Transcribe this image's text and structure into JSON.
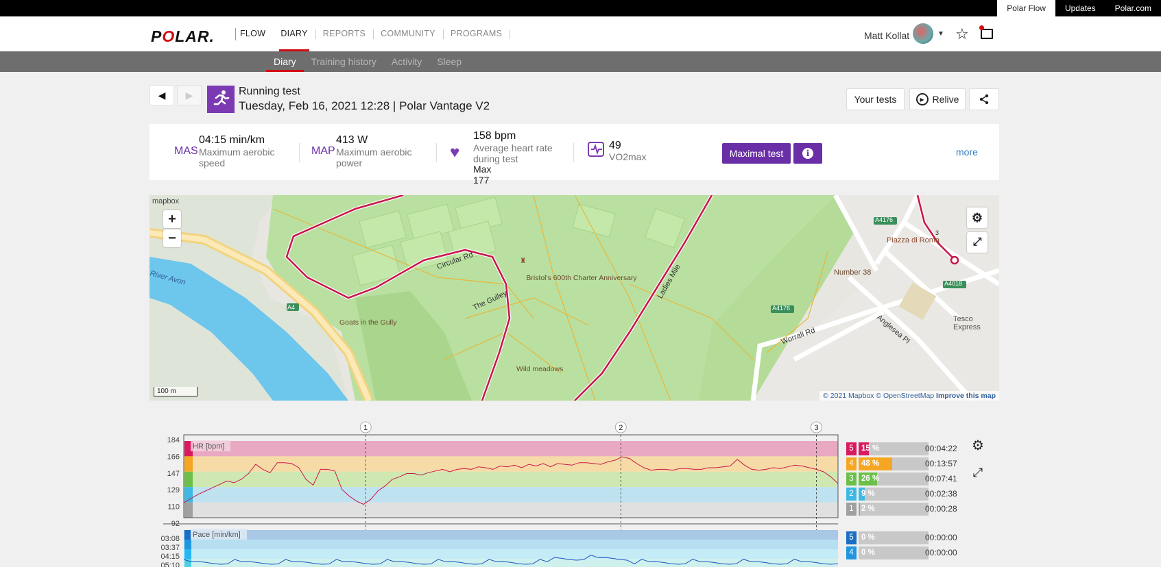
{
  "topbar": {
    "links": [
      "Polar Flow",
      "Updates",
      "Polar.com"
    ],
    "active": "Polar Flow"
  },
  "brand": {
    "logo_text": "POLAR."
  },
  "nav": {
    "items": [
      {
        "label": "FLOW"
      },
      {
        "label": "DIARY"
      },
      {
        "label": "REPORTS"
      },
      {
        "label": "COMMUNITY"
      },
      {
        "label": "PROGRAMS"
      }
    ],
    "active": "DIARY"
  },
  "user": {
    "name": "Matt Kollat"
  },
  "icons": {
    "star": "star-icon",
    "messages": "messages-icon",
    "avatar": "avatar"
  },
  "subnav": {
    "items": [
      "Diary",
      "Training history",
      "Activity",
      "Sleep"
    ],
    "active": "Diary"
  },
  "session": {
    "title": "Running test",
    "subtitle": "Tuesday, Feb 16, 2021 12:28 | Polar Vantage V2",
    "buttons": {
      "tests": "Your tests",
      "relive": "Relive"
    }
  },
  "summary": {
    "mas": {
      "abbr": "MAS",
      "value": "04:15 min/km",
      "desc": "Maximum aerobic speed"
    },
    "map": {
      "abbr": "MAP",
      "value": "413 W",
      "desc": "Maximum aerobic power"
    },
    "hr": {
      "value": "158 bpm",
      "desc": "Average heart rate during test",
      "max": "Max 177"
    },
    "vo2": {
      "value": "49",
      "desc": "VO2max"
    },
    "maximal_test_label": "Maximal test",
    "more_label": "more"
  },
  "map": {
    "labels": {
      "mapbox": "mapbox",
      "scale": "100 m",
      "circular_rd": "Circular Rd",
      "charter": "Bristol's 600th Charter Anniversary",
      "gulley": "The Gulley",
      "goats": "Goats in the Gully",
      "wild": "Wild meadows",
      "ladies": "Ladies Mile",
      "piazza": "Piazza di Roma",
      "number38": "Number 38",
      "tesco": "Tesco Express",
      "worrall": "Worrall Rd",
      "anglesea": "Anglesea Pl",
      "avon": "River Avon",
      "a4": "A4",
      "a4176a": "A4176",
      "a4176b": "A4176",
      "a4018": "A4018",
      "lap3": "3"
    },
    "attribution": {
      "copy": "© 2021 Mapbox",
      "osm": "© OpenStreetMap",
      "improve": "Improve this map"
    },
    "controls": {
      "zoom_in": "+",
      "zoom_out": "−"
    }
  },
  "chart_data": [
    {
      "type": "line",
      "title": "HR [bpm]",
      "ylabel": "HR [bpm]",
      "y_ticks": [
        "184",
        "166",
        "147",
        "129",
        "110",
        "92"
      ],
      "ylim": [
        92,
        184
      ],
      "lap_markers": [
        "1",
        "2",
        "3"
      ],
      "lap_positions_fraction": [
        0.278,
        0.668,
        0.967
      ],
      "zones": [
        {
          "zone": "5",
          "percent": "15 %",
          "time": "00:04:22",
          "color": "#d81b60"
        },
        {
          "zone": "4",
          "percent": "48 %",
          "time": "00:13:57",
          "color": "#f5a623"
        },
        {
          "zone": "3",
          "percent": "26 %",
          "time": "00:07:41",
          "color": "#6cc04a"
        },
        {
          "zone": "2",
          "percent": "9 %",
          "time": "00:02:38",
          "color": "#3fb9e3"
        },
        {
          "zone": "1",
          "percent": "2 %",
          "time": "00:00:28",
          "color": "#a0a0a0"
        }
      ],
      "series": [
        {
          "values": [
            110,
            115,
            120,
            124,
            128,
            132,
            136,
            134,
            138,
            145,
            156,
            150,
            146,
            158,
            158,
            157,
            152,
            138,
            131,
            150,
            150,
            148,
            126,
            118,
            112,
            108,
            114,
            124,
            130,
            138,
            141,
            145,
            145,
            143,
            146,
            148,
            150,
            147,
            150,
            151,
            150,
            153,
            152,
            150,
            154,
            153,
            155,
            152,
            156,
            154,
            157,
            153,
            157,
            156,
            155,
            158,
            158,
            157,
            156,
            159,
            161,
            165,
            163,
            157,
            152,
            149,
            150,
            150,
            149,
            151,
            151,
            150,
            150,
            152,
            152,
            153,
            154,
            162,
            155,
            150,
            149,
            150,
            152,
            151,
            153,
            155,
            154,
            152,
            150,
            147,
            141,
            133
          ]
        }
      ]
    },
    {
      "type": "line",
      "title": "Pace [min/km]",
      "ylabel": "Pace [min/km]",
      "y_ticks": [
        "03:08",
        "03:37",
        "04:15",
        "05:10"
      ],
      "zones": [
        {
          "zone": "5",
          "percent": "0 %",
          "time": "00:00:00",
          "color": "#1a6fc4"
        },
        {
          "zone": "4",
          "percent": "0 %",
          "time": "00:00:00",
          "color": "#2196e0"
        }
      ]
    }
  ]
}
